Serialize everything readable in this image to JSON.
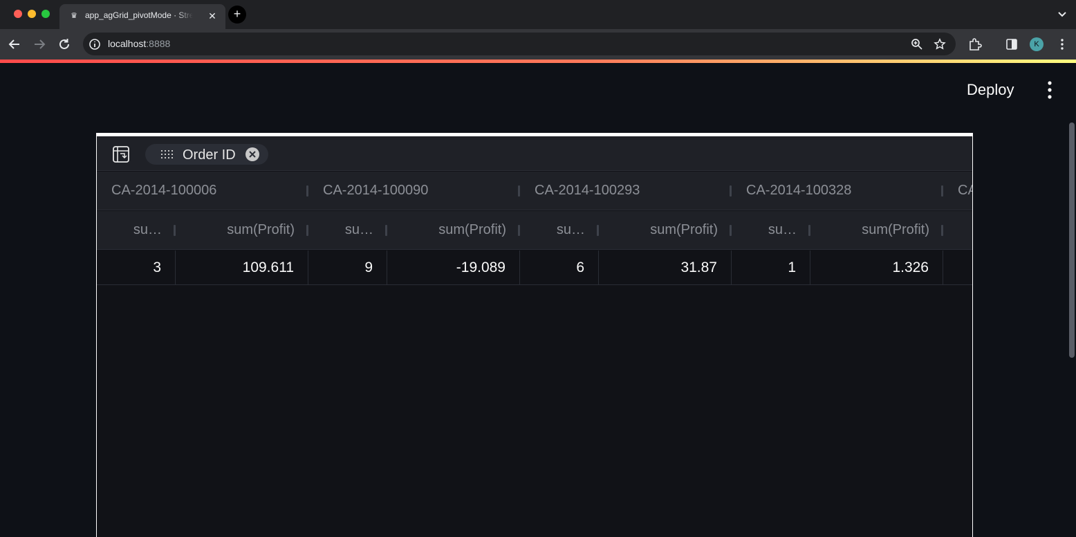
{
  "browser": {
    "tab_title": "app_agGrid_pivotMode · Streamlit",
    "url_host": "localhost",
    "url_port": ":8888",
    "profile_initial": "K"
  },
  "app": {
    "deploy_label": "Deploy"
  },
  "grid": {
    "pivot_chip_label": "Order ID",
    "group_headers": [
      "CA-2014-100006",
      "CA-2014-100090",
      "CA-2014-100293",
      "CA-2014-100328",
      "CA"
    ],
    "column_headers": [
      "su…",
      "sum(Profit)",
      "su…",
      "sum(Profit)",
      "su…",
      "sum(Profit)",
      "su…",
      "sum(Profit)"
    ],
    "row": [
      "3",
      "109.611",
      "9",
      "-19.089",
      "6",
      "31.87",
      "1",
      "1.326"
    ]
  },
  "colors": {
    "accent_red": "#ff4b4b",
    "background": "#0e1117",
    "grid_header": "#1f2127"
  }
}
